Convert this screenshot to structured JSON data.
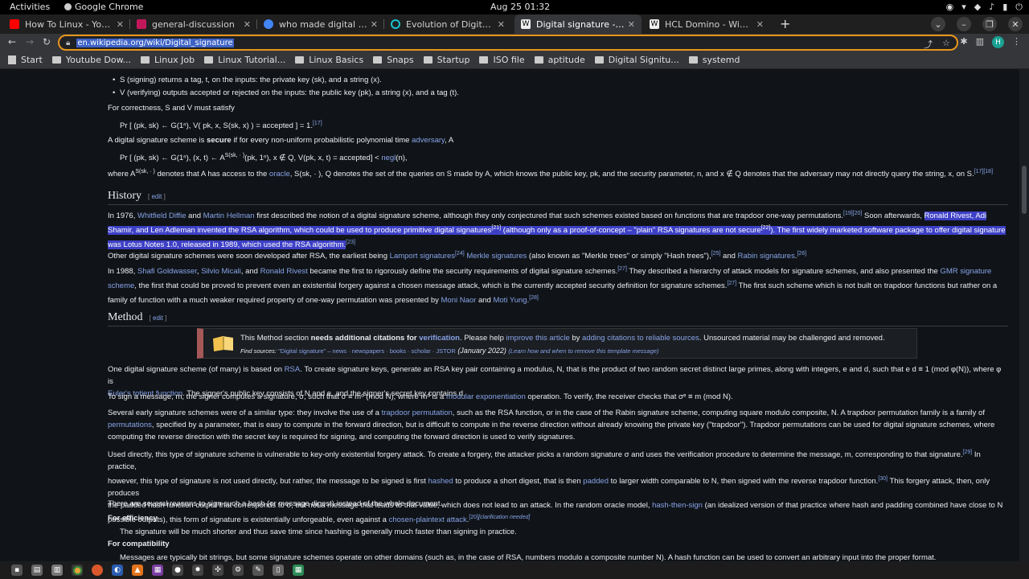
{
  "topbar": {
    "activities": "Activities",
    "app": "Google Chrome",
    "clock": "Aug 25  01:32"
  },
  "tabs": [
    {
      "title": "How To Linux - YouTube",
      "color": "#ff0000"
    },
    {
      "title": "general-discussion",
      "color": "#c2185b"
    },
    {
      "title": "who made digital signatu",
      "color": "#4285f4"
    },
    {
      "title": "Evolution of Digital Signa",
      "color": "#19c3d1"
    },
    {
      "title": "Digital signature - Wikipe",
      "color": "#eeeeee"
    },
    {
      "title": "HCL Domino - Wikipedia",
      "color": "#eeeeee"
    }
  ],
  "omnibox": {
    "url": "en.wikipedia.org/wiki/Digital_signature"
  },
  "profile_initial": "H",
  "bookmarks": [
    {
      "label": "Start",
      "kind": "page"
    },
    {
      "label": "Youtube Dow...",
      "kind": "folder"
    },
    {
      "label": "Linux Job",
      "kind": "folder"
    },
    {
      "label": "Linux Tutorial...",
      "kind": "folder"
    },
    {
      "label": "Linux Basics",
      "kind": "folder"
    },
    {
      "label": "Snaps",
      "kind": "folder"
    },
    {
      "label": "Startup",
      "kind": "folder"
    },
    {
      "label": "ISO file",
      "kind": "folder"
    },
    {
      "label": "aptitude",
      "kind": "folder"
    },
    {
      "label": "Digital Signitu...",
      "kind": "folder"
    },
    {
      "label": "systemd",
      "kind": "folder"
    }
  ],
  "article": {
    "bullet_s": "S (signing) returns a tag, t, on the inputs: the private key (sk), and a string (x).",
    "bullet_v": "V (verifying) outputs accepted or rejected on the inputs: the public key (pk), a string (x), and a tag (t).",
    "correctness": "For correctness, S and V must satisfy",
    "formula1": "Pr [ (pk, sk) ← G(1ⁿ), V( pk, x, S(sk, x) ) = accepted ] = 1.",
    "formula1_ref": "[17]",
    "secure_pre": "A digital signature scheme is ",
    "secure_bold": "secure",
    "secure_mid": " if for every non-uniform probabilistic polynomial time ",
    "secure_link": "adversary",
    "secure_end": ", A",
    "formula2_pre": "Pr [ (pk, sk) ← G(1ⁿ), (x, t) ← A",
    "formula2_sup": "S(sk, · )",
    "formula2_mid": "(pk, 1ⁿ), x ∉ Q, V(pk, x, t) = accepted] < ",
    "formula2_link": "negl",
    "formula2_end": "(n),",
    "where_pre": "where A",
    "where_sup": "S(sk, · )",
    "where_mid": " denotes that A has access to the ",
    "where_link": "oracle",
    "where_end": ", S(sk, · ), Q denotes the set of the queries on S made by A, which knows the public key, pk, and the security parameter, n, and x ∉ Q denotes that the adversary may not directly query the string, x, on S.",
    "where_ref": "[17][18]",
    "history_heading": "History",
    "edit": "edit",
    "h1_a": "In 1976, ",
    "h1_l1": "Whitfield Diffie",
    "h1_b": " and ",
    "h1_l2": "Martin Hellman",
    "h1_c": " first described the notion of a digital signature scheme, although they only conjectured that such schemes existed based on functions that are trapdoor one-way permutations.",
    "h1_ref": "[19][20]",
    "h1_d": " Soon afterwards, ",
    "h1_sel1": "Ronald Rivest, Adi Shamir, and Len Adleman invented the RSA algorithm, which could be used to produce primitive digital signatures",
    "h1_ref2": "[21]",
    "h1_sel2": " (although only as a proof-of-concept – \"plain\" RSA signatures are not secure",
    "h1_ref3": "[22]",
    "h1_sel3": "). The first widely marketed software package to offer digital signature was Lotus Notes 1.0, released in 1989, which used the RSA algorithm.",
    "h1_ref4": "[23]",
    "h2_a": "Other digital signature schemes were soon developed after RSA, the earliest being ",
    "h2_l1": "Lamport signatures",
    "h2_r1": "[24]",
    "h2_b": " ",
    "h2_l2": "Merkle signatures",
    "h2_c": " (also known as \"Merkle trees\" or simply \"Hash trees\"),",
    "h2_r2": "[25]",
    "h2_d": " and ",
    "h2_l3": "Rabin signatures",
    "h2_r3": "[26]",
    "h3_a": "In 1988, ",
    "h3_l1": "Shafi Goldwasser",
    "h3_b": ", ",
    "h3_l2": "Silvio Micali",
    "h3_c": ", and ",
    "h3_l3": "Ronald Rivest",
    "h3_d": " became the first to rigorously define the security requirements of digital signature schemes.",
    "h3_r1": "[27]",
    "h3_e": " They described a hierarchy of attack models for signature schemes, and also presented the ",
    "h3_l4": "GMR signature scheme",
    "h3_f": ", the first that could be proved to prevent even an existential forgery against a chosen message attack, which is the currently accepted security definition for signature schemes.",
    "h3_r2": "[27]",
    "h3_g": " The first such scheme which is not built on trapdoor functions but rather on a family of function with a much weaker required property of one-way permutation was presented by ",
    "h3_l5": "Moni Naor",
    "h3_h": " and ",
    "h3_l6": "Moti Yung",
    "h3_r3": "[28]",
    "method_heading": "Method",
    "ambox_a": "This Method section ",
    "ambox_bold": "needs additional citations for ",
    "ambox_link": "verification",
    "ambox_b": ". Please help ",
    "ambox_l2": "improve this article",
    "ambox_c": " by ",
    "ambox_l3": "adding citations to reliable sources",
    "ambox_d": ". Unsourced material may be challenged and removed.",
    "ambox_find": "Find sources: ",
    "ambox_sources": "\"Digital signature\" – news · newspapers · books · scholar · JSTOR",
    "ambox_date": " (January 2022) ",
    "ambox_learn": "(Learn how and when to remove this template message)",
    "m1_a": "One digital signature scheme (of many) is based on ",
    "m1_l1": "RSA",
    "m1_b": ". To create signature keys, generate an RSA key pair containing a modulus, N, that is the product of two random secret distinct large primes, along with integers, e and d, such that e d ≡ 1 (mod φ(N)), where φ is",
    "m1_l2": "Euler's totient function",
    "m1_c": ". The signer's public key consists of N and e, and the signer's secret key contains d.",
    "m2_a": "To sign a message, m, the signer computes a signature, σ, such that σ ≡ mᵈ (mod N), where mᵈ is a ",
    "m2_l1": "modular exponentiation",
    "m2_b": " operation. To verify, the receiver checks that σᵉ ≡ m (mod N).",
    "m3_a": "Several early signature schemes were of a similar type: they involve the use of a ",
    "m3_l1": "trapdoor permutation",
    "m3_b": ", such as the RSA function, or in the case of the Rabin signature scheme, computing square modulo composite, N. A trapdoor permutation family is a family of",
    "m3_l2": "permutations",
    "m3_c": ", specified by a parameter, that is easy to compute in the forward direction, but is difficult to compute in the reverse direction without already knowing the private key (\"trapdoor\"). Trapdoor permutations can be used for digital signature schemes, where",
    "m3_d": "computing the reverse direction with the secret key is required for signing, and computing the forward direction is used to verify signatures.",
    "m4_a": "Used directly, this type of signature scheme is vulnerable to key-only existential forgery attack. To create a forgery, the attacker picks a random signature σ and uses the verification procedure to determine the message, m, corresponding to that signature.",
    "m4_r1": "[29]",
    "m4_b": " In practice,",
    "m4_c": "however, this type of signature is not used directly, but rather, the message to be signed is first ",
    "m4_l1": "hashed",
    "m4_d": " to produce a short digest, that is then ",
    "m4_l2": "padded",
    "m4_e": " to larger width comparable to N, then signed with the reverse trapdoor function.",
    "m4_r2": "[30]",
    "m4_f": " This forgery attack, then, only produces",
    "m4_g": "the padded hash function output that corresponds to σ, but not a message that leads to that value, which does not lead to an attack. In the random oracle model, ",
    "m4_l3": "hash-then-sign",
    "m4_h": " (an idealized version of that practice where hash and padding combined have close to N",
    "m4_i": "possible outputs), this form of signature is existentially unforgeable, even against a ",
    "m4_l4": "chosen-plaintext attack",
    "m4_r3": "[20]",
    "m4_r4": "[clarification needed]",
    "m5": "There are several reasons to sign such a hash (or message digest) instead of the whole document.",
    "eff_h": "For efficiency",
    "eff_t": "The signature will be much shorter and thus save time since hashing is generally much faster than signing in practice.",
    "compat_h": "For compatibility",
    "compat_t": "Messages are typically bit strings, but some signature schemes operate on other domains (such as, in the case of RSA, numbers modulo a composite number N). A hash function can be used to convert an arbitrary input into the proper format."
  },
  "dock_icons": [
    "terminal-icon",
    "files-icon",
    "text-editor-icon",
    "chrome-icon",
    "firefox-icon",
    "steam-icon",
    "vlc-icon",
    "notepad-icon",
    "app-icon",
    "app-icon-2",
    "gear-app-icon",
    "settings-icon",
    "editor-icon",
    "document-icon",
    "spreadsheet-icon"
  ]
}
